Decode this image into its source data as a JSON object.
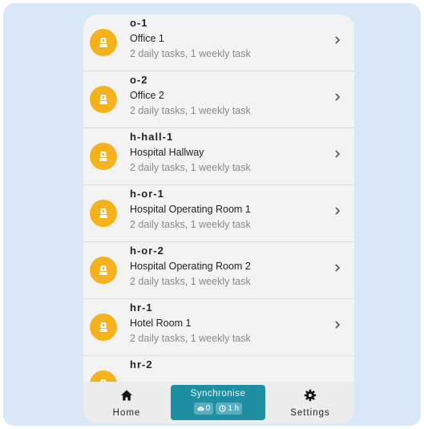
{
  "rooms": [
    {
      "code": "o-1",
      "name": "Office 1",
      "desc": "2 daily tasks, 1 weekly task"
    },
    {
      "code": "o-2",
      "name": "Office 2",
      "desc": "2 daily tasks, 1 weekly task"
    },
    {
      "code": "h-hall-1",
      "name": "Hospital Hallway",
      "desc": "2 daily tasks, 1 weekly task"
    },
    {
      "code": "h-or-1",
      "name": "Hospital Operating Room 1",
      "desc": "2 daily tasks, 1 weekly task"
    },
    {
      "code": "h-or-2",
      "name": "Hospital Operating Room 2",
      "desc": "2 daily tasks, 1 weekly task"
    },
    {
      "code": "hr-1",
      "name": "Hotel Room 1",
      "desc": "2 daily tasks, 1 weekly task"
    },
    {
      "code": "hr-2",
      "name": "",
      "desc": ""
    }
  ],
  "bottom_nav": {
    "home_label": "Home",
    "settings_label": "Settings",
    "sync": {
      "title": "Synchronise",
      "pending_count": "0",
      "last_sync": "1 h"
    }
  },
  "colors": {
    "avatar": "#f5b21c",
    "sync_button": "#1e8fa3",
    "background": "#d9e8f6"
  },
  "icons": {
    "room_avatar": "broom-icon",
    "row_chevron": "chevron-right-icon",
    "home": "home-icon",
    "settings": "gear-icon",
    "pending": "cloud-upload-icon",
    "last_sync": "clock-icon"
  }
}
